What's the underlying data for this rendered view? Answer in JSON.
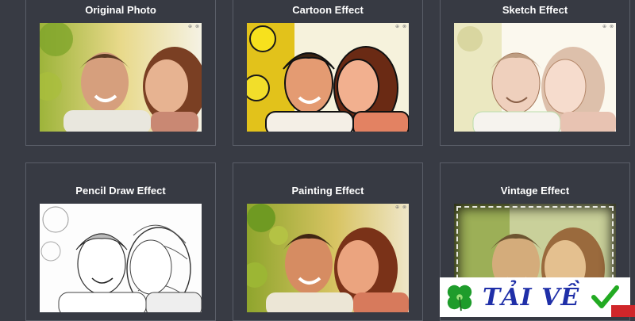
{
  "effects": [
    {
      "title": "Original Photo",
      "style": "original"
    },
    {
      "title": "Cartoon Effect",
      "style": "cartoon"
    },
    {
      "title": "Sketch Effect",
      "style": "sketch"
    },
    {
      "title": "Pencil Draw Effect",
      "style": "pencil"
    },
    {
      "title": "Painting Effect",
      "style": "painting"
    },
    {
      "title": "Vintage Effect",
      "style": "vintage"
    }
  ],
  "corner_icons": "⊕ ⊗",
  "watermark": {
    "text": "TẢI VỀ",
    "logo_icon": "four-leaf-clover-icon",
    "check_icon": "green-checkmark-icon",
    "brand_color": "#1f2fa8",
    "clover_color": "#1e9c2b",
    "check_color": "#22aa22"
  },
  "colors": {
    "background": "#383b44",
    "card_border": "#5a5e68",
    "title_text": "#ffffff"
  }
}
